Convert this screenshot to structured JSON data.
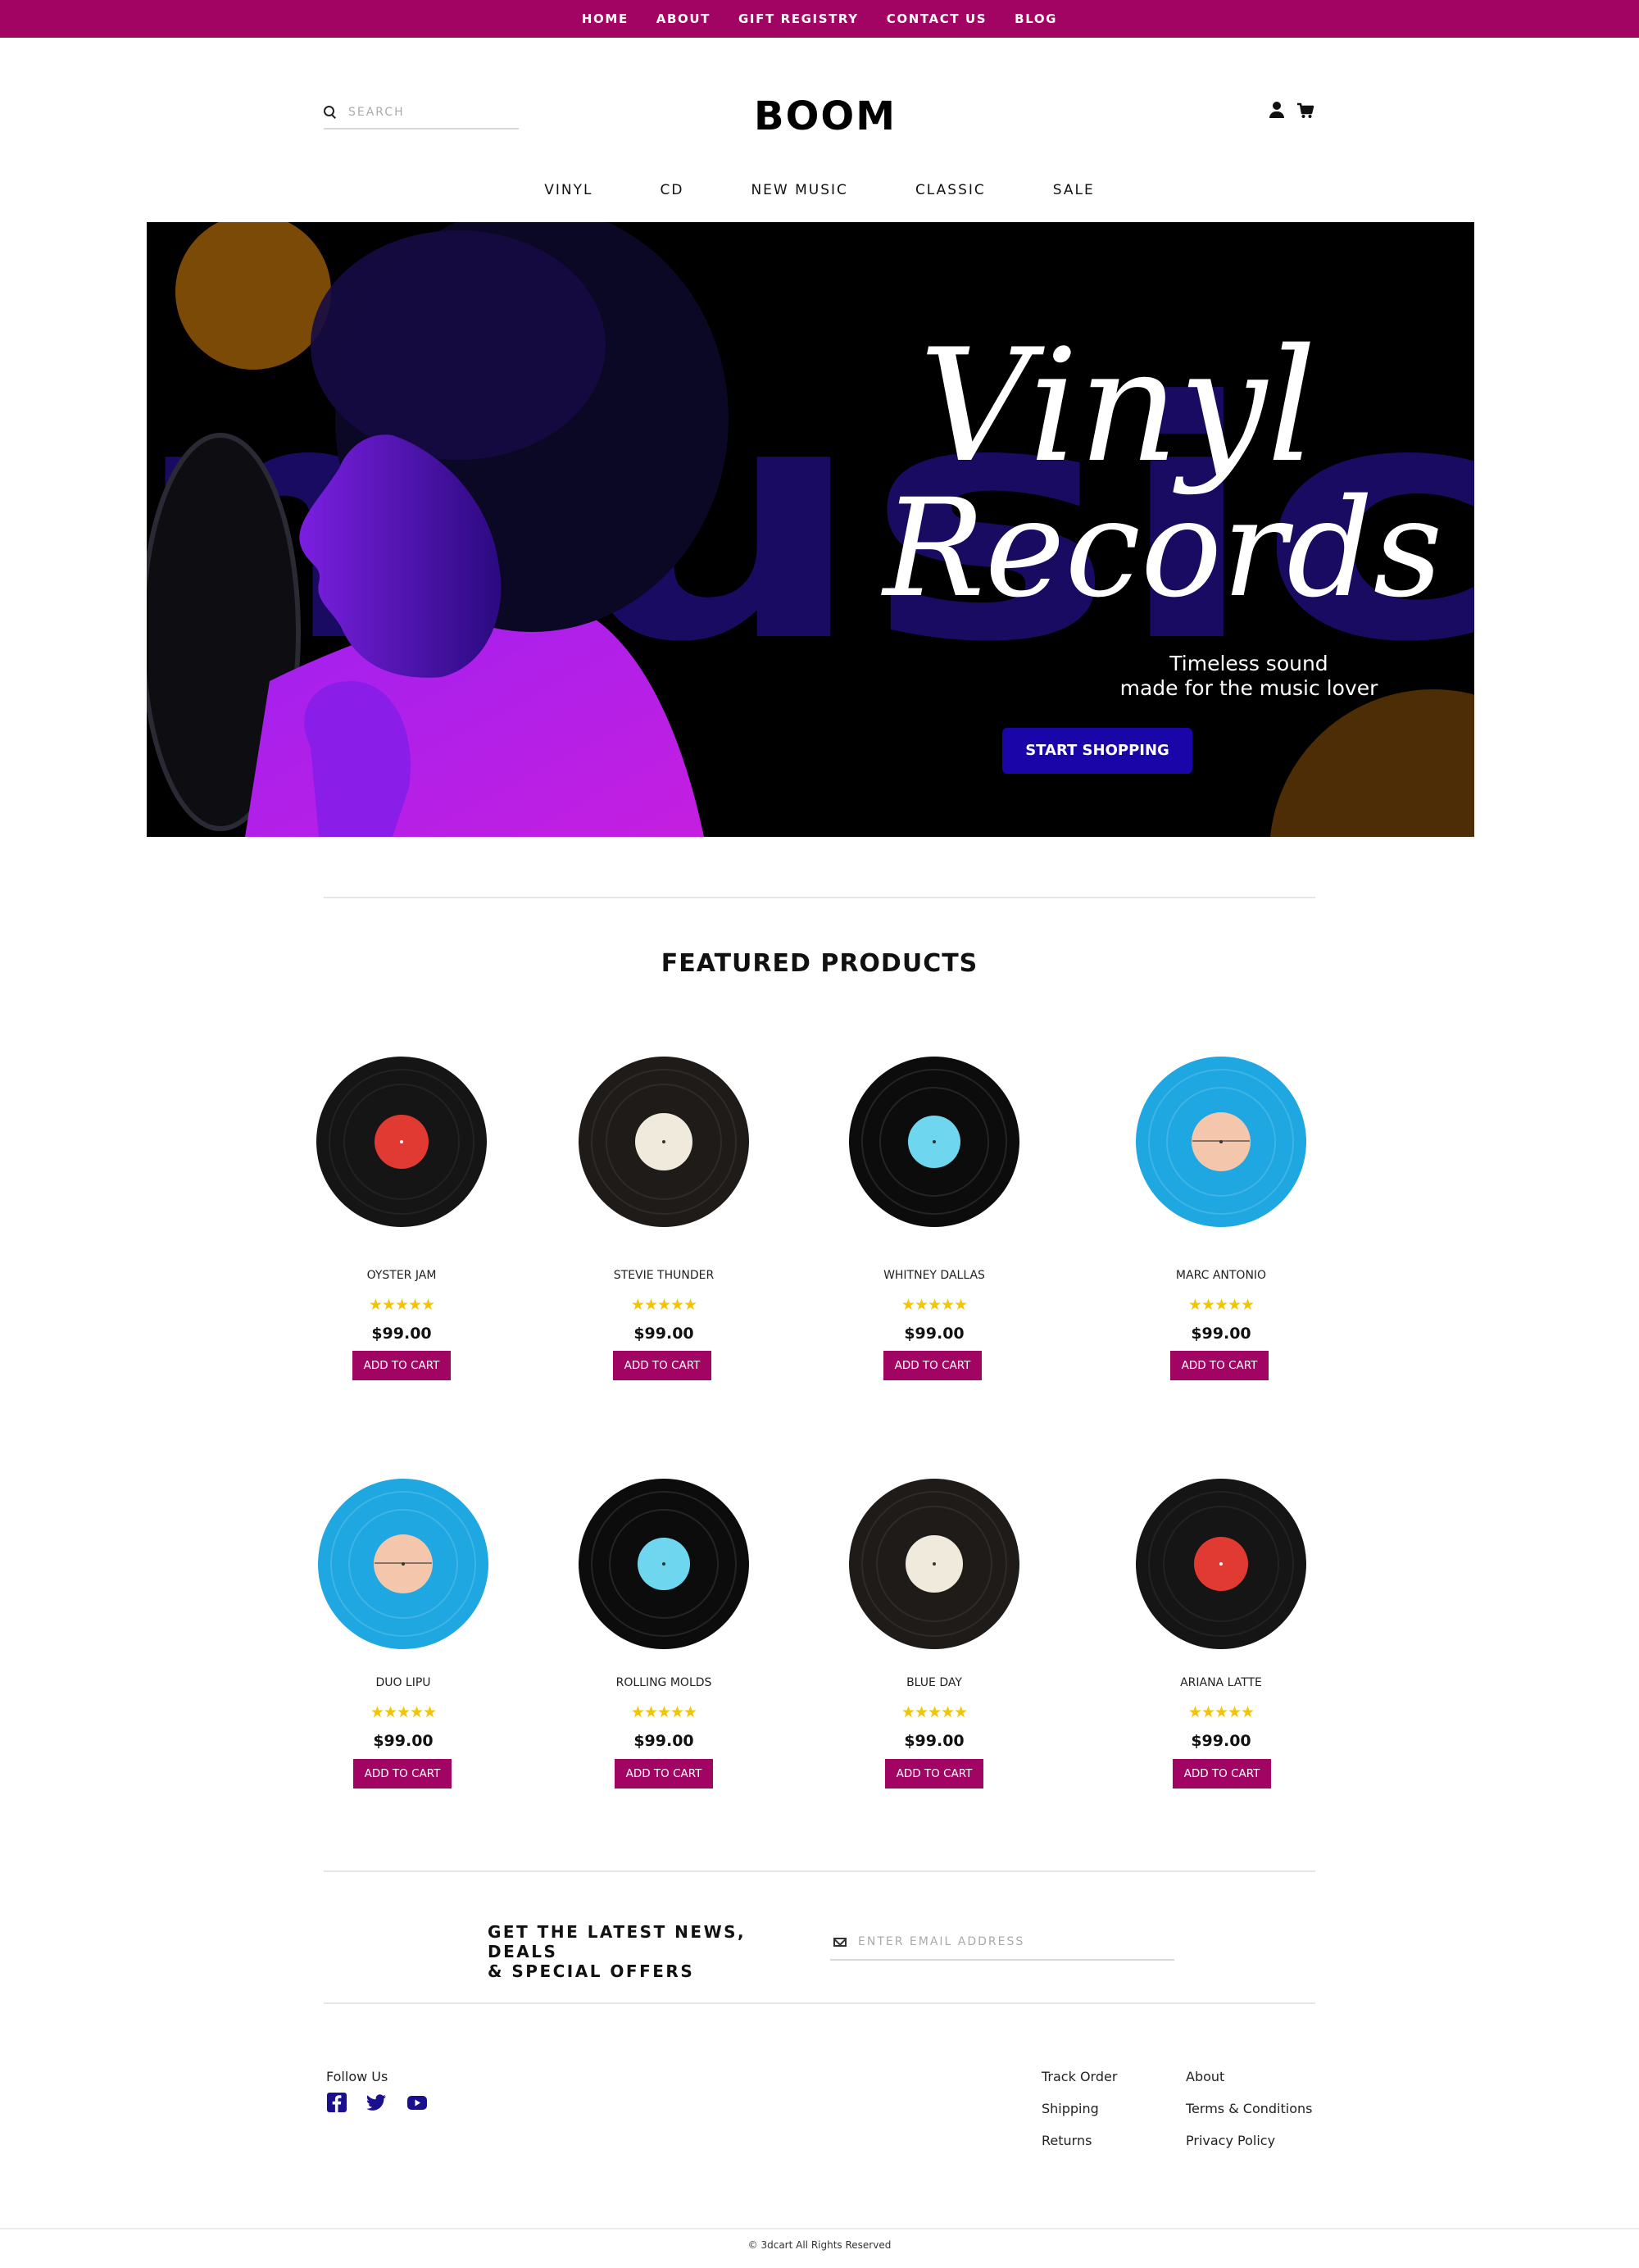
{
  "topnav": [
    "HOME",
    "ABOUT",
    "GIFT REGISTRY",
    "CONTACT US",
    "BLOG"
  ],
  "header": {
    "search_placeholder": "SEARCH",
    "logo": "BOOM",
    "user_icon": "user-icon",
    "cart_icon": "cart-icon"
  },
  "mainnav": [
    "VINYL",
    "CD",
    "NEW MUSIC",
    "CLASSIC",
    "SALE"
  ],
  "hero": {
    "bg_word": "music",
    "title_line1": "Vinyl",
    "title_line2": "Records",
    "subtitle_line1": "Timeless sound",
    "subtitle_line2": "made for the music lover",
    "cta": "START SHOPPING"
  },
  "featured": {
    "title": "FEATURED PRODUCTS",
    "rating_glyphs": "★★★★★",
    "add_label": "ADD TO CART",
    "products": [
      {
        "name": "OYSTER JAM",
        "price": "$99.00",
        "disc": "#151515",
        "label": "#e03a32"
      },
      {
        "name": "STEVIE THUNDER",
        "price": "$99.00",
        "disc": "#1e1b19",
        "label": "#efeadb"
      },
      {
        "name": "WHITNEY DALLAS",
        "price": "$99.00",
        "disc": "#0c0c0c",
        "label": "#6fd6ef"
      },
      {
        "name": "MARC ANTONIO",
        "price": "$99.00",
        "disc": "#1ea7e1",
        "label": "#f4c6ac"
      },
      {
        "name": "DUO LIPU",
        "price": "$99.00",
        "disc": "#1ea7e1",
        "label": "#f4c6ac"
      },
      {
        "name": "ROLLING MOLDS",
        "price": "$99.00",
        "disc": "#0c0c0c",
        "label": "#6fd6ef"
      },
      {
        "name": "BLUE DAY",
        "price": "$99.00",
        "disc": "#1e1b19",
        "label": "#efeadb"
      },
      {
        "name": "ARIANA LATTE",
        "price": "$99.00",
        "disc": "#151515",
        "label": "#e03a32"
      }
    ]
  },
  "newsletter": {
    "title_line1": "GET THE LATEST NEWS, DEALS",
    "title_line2": "& SPECIAL OFFERS",
    "email_placeholder": "ENTER EMAIL ADDRESS"
  },
  "footer": {
    "follow": "Follow Us",
    "social_icons": [
      "facebook-icon",
      "twitter-icon",
      "youtube-icon"
    ],
    "col1": [
      "Track Order",
      "Shipping",
      "Returns"
    ],
    "col2": [
      "About",
      "Terms & Conditions",
      "Privacy Policy"
    ],
    "copyright": "© 3dcart All Rights Reserved"
  },
  "colors": {
    "brand": "#a10462",
    "cta": "#1a05a8",
    "star": "#f5c400",
    "social": "#1a0f8e"
  }
}
